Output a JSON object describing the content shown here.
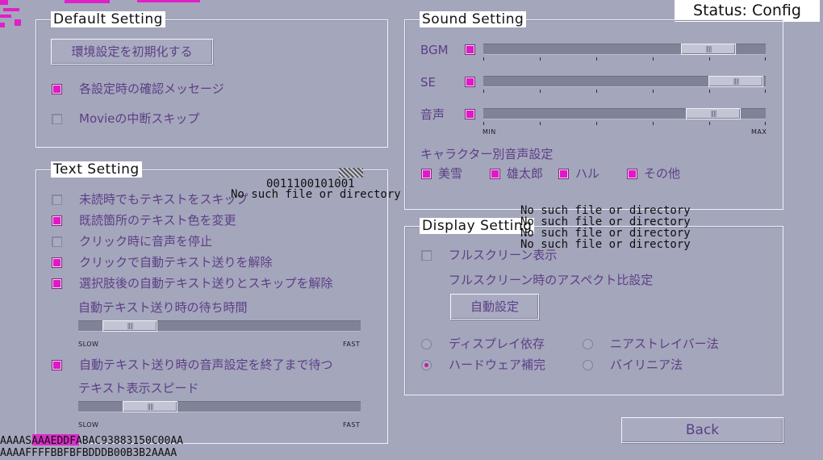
{
  "status": "Status: Config",
  "default_setting": {
    "title": "Default Setting",
    "reset_button": "環境設定を初期化する",
    "confirm_message": {
      "label": "各設定時の確認メッセージ",
      "checked": true
    },
    "movie_skip": {
      "label": "Movieの中断スキップ",
      "checked": false
    }
  },
  "text_setting": {
    "title": "Text Setting",
    "options": [
      {
        "label": "未読時でもテキストをスキップ",
        "checked": false
      },
      {
        "label": "既読箇所のテキスト色を変更",
        "checked": true
      },
      {
        "label": "クリック時に音声を停止",
        "checked": false
      },
      {
        "label": "クリックで自動テキスト送りを解除",
        "checked": true
      },
      {
        "label": "選択肢後の自動テキスト送りとスキップを解除",
        "checked": true
      }
    ],
    "auto_wait": {
      "label": "自動テキスト送り時の待ち時間",
      "min_label": "SLOW",
      "max_label": "FAST",
      "value": 0.1
    },
    "wait_voice": {
      "label": "自動テキスト送り時の音声設定を終了まで待つ",
      "checked": true
    },
    "text_speed": {
      "label": "テキスト表示スピード",
      "min_label": "SLOW",
      "max_label": "FAST",
      "value": 0.18
    }
  },
  "sound_setting": {
    "title": "Sound Setting",
    "channels": [
      {
        "label": "BGM",
        "checked": true,
        "value": 0.81
      },
      {
        "label": "SE",
        "checked": true,
        "value": 0.92
      },
      {
        "label": "音声",
        "checked": true,
        "value": 0.82
      }
    ],
    "min_label": "MIN",
    "max_label": "MAX",
    "character_voice_label": "キャラクター別音声設定",
    "characters": [
      {
        "label": "美雪",
        "checked": true
      },
      {
        "label": "雄太郎",
        "checked": true
      },
      {
        "label": "ハル",
        "checked": true
      },
      {
        "label": "その他",
        "checked": true
      }
    ]
  },
  "display_setting": {
    "title": "Display Setting",
    "fullscreen": {
      "label": "フルスクリーン表示",
      "checked": false
    },
    "aspect_label": "フルスクリーン時のアスペクト比設定",
    "auto_button": "自動設定",
    "radios": [
      {
        "label": "ディスプレイ依存",
        "selected": false
      },
      {
        "label": "ニアストレイバー法",
        "selected": false
      },
      {
        "label": "ハードウェア補完",
        "selected": true
      },
      {
        "label": "バイリニア法",
        "selected": false
      }
    ]
  },
  "back_button": "Back",
  "errors": {
    "binary": "0011100101001",
    "no_file": "No such file or directory",
    "no_file_list": [
      "No such file or directory",
      "No such file or directory",
      "No such file or directory",
      "No such file or directory"
    ],
    "hex1": "AAAASAAAEDDFABAC93883150C00AA",
    "hex2": "AAAAFFFFBBFBFBDDDB00B3B2AAAA"
  },
  "colors": {
    "background": "#a4a6bc",
    "label_text": "#5c3f85",
    "checkbox_on": "#e018c8"
  }
}
